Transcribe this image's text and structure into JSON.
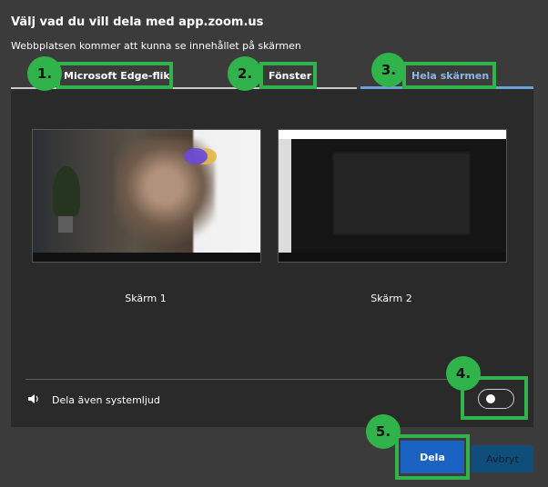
{
  "dialog": {
    "title": "Välj vad du vill dela med app.zoom.us",
    "subtitle": "Webbplatsen kommer att kunna se innehållet på skärmen"
  },
  "tabs": [
    {
      "label": "Microsoft Edge-flik",
      "active": false
    },
    {
      "label": "Fönster",
      "active": false
    },
    {
      "label": "Hela skärmen",
      "active": true
    }
  ],
  "screens": [
    {
      "label": "Skärm 1"
    },
    {
      "label": "Skärm 2"
    }
  ],
  "audio": {
    "label": "Dela även systemljud",
    "enabled": false
  },
  "buttons": {
    "share": "Dela",
    "cancel": "Avbryt"
  },
  "annotations": [
    "1.",
    "2.",
    "3.",
    "4.",
    "5."
  ],
  "colors": {
    "highlight": "#2fb34a",
    "primary": "#1a63c2",
    "active_tab": "#6aa1d8"
  }
}
